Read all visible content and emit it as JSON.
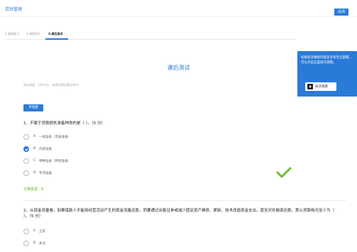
{
  "header": {
    "title": "贷后管理",
    "close_label": "关闭"
  },
  "tabs": [
    {
      "label": "1.课程复习"
    },
    {
      "label": "2.课程评价"
    },
    {
      "label": "3.课后测试"
    }
  ],
  "quiz": {
    "title": "课后测试",
    "info": "测试成绩：100.0分。 恭喜您顺利通过考试！",
    "type_label": "单选题"
  },
  "side_panel": {
    "text": "如果您对课程内容还没有完全掌握，可以点击这里再次观看。",
    "rewatch_label": "再次观看"
  },
  "questions": [
    {
      "text": "1、不属于贷款损失准备种类的是（ ）。（5 分）",
      "options": [
        {
          "letter": "A",
          "text": "一般准备（普通准备）"
        },
        {
          "letter": "B",
          "text": "内部准备"
        },
        {
          "letter": "C",
          "text": "特种准备（特别准备）"
        },
        {
          "letter": "D",
          "text": "专项准备"
        }
      ],
      "selected": "B",
      "answer_label": "正确答案：B"
    },
    {
      "text": "2、从现金流量看，如果借款人不能用经营活动产生的现金流量还款，而要通过出售证券或减少固定资产维修、更新、技术改造现金支出，甚至对外融资还款，那么贷款档次至少为（ ）。（5 分）",
      "options": [
        {
          "letter": "A",
          "text": "正常"
        },
        {
          "letter": "B",
          "text": "关注"
        }
      ]
    }
  ],
  "colors": {
    "accent": "#2a7bd8",
    "correct": "#6cbf2a"
  }
}
